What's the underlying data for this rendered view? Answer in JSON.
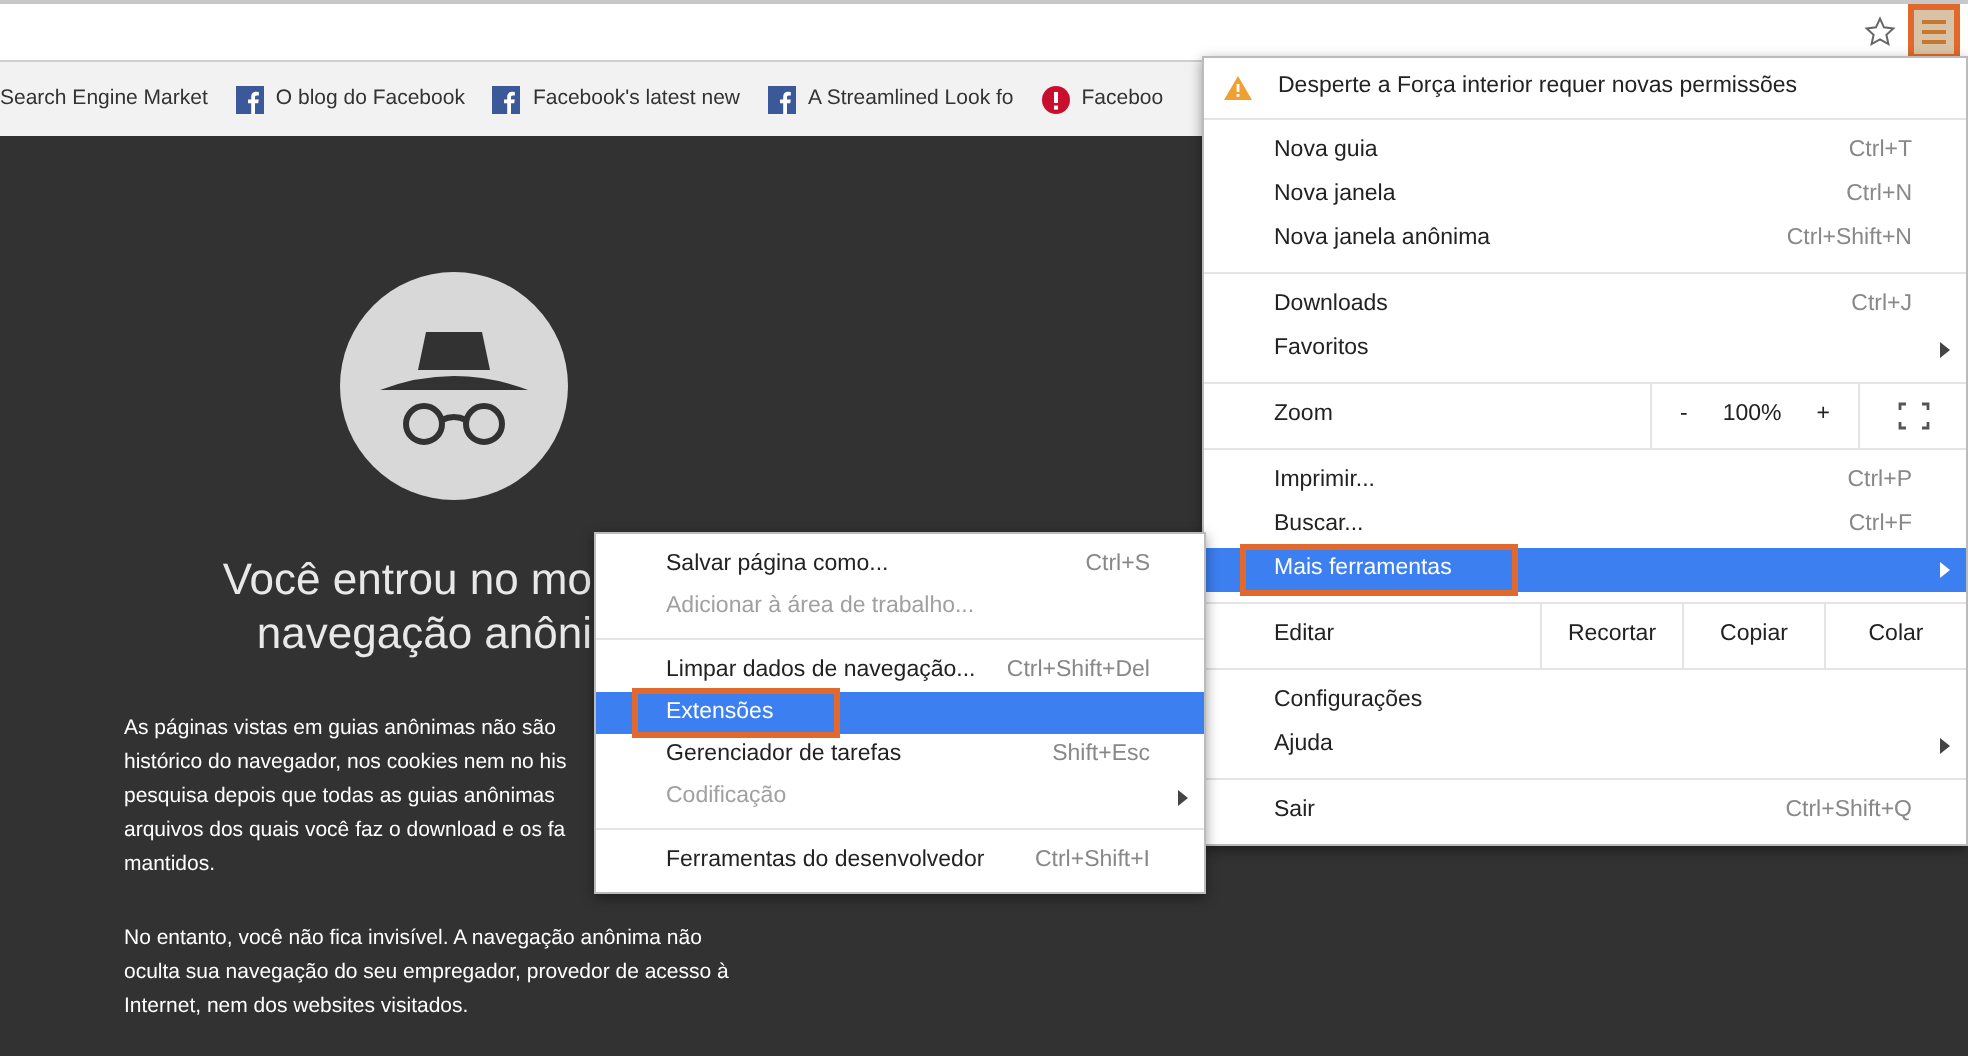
{
  "toolbar": {
    "menu_button": {
      "annotated": true
    }
  },
  "bookmarks": [
    {
      "kind": "plain",
      "label": "Search Engine Market"
    },
    {
      "kind": "facebook",
      "label": "O blog do Facebook"
    },
    {
      "kind": "facebook",
      "label": "Facebook's latest new"
    },
    {
      "kind": "facebook",
      "label": "A Streamlined Look fo"
    },
    {
      "kind": "alert",
      "label": "Faceboo"
    }
  ],
  "page": {
    "heading_lines": [
      "Você entrou no mo",
      "navegação anôni"
    ],
    "paragraphs": [
      [
        "As páginas vistas em guias anônimas não são",
        "histórico do navegador, nos cookies nem no his",
        "pesquisa depois que todas as guias anônimas",
        "arquivos dos quais você faz o download e os fa",
        "mantidos."
      ],
      [
        "No entanto, você não fica invisível. A navegação anônima não",
        "oculta sua navegação do seu empregador, provedor de acesso à",
        "Internet, nem dos websites visitados."
      ]
    ]
  },
  "menu": {
    "sections": [
      {
        "items": [
          {
            "kind": "warning",
            "label": "Desperte a Força interior requer novas permissões"
          }
        ]
      },
      {
        "items": [
          {
            "kind": "item",
            "label": "Nova guia",
            "shortcut": "Ctrl+T",
            "submenu": false,
            "selected": false,
            "disabled": false,
            "annotated": false
          },
          {
            "kind": "item",
            "label": "Nova janela",
            "shortcut": "Ctrl+N",
            "submenu": false,
            "selected": false,
            "disabled": false,
            "annotated": false
          },
          {
            "kind": "item",
            "label": "Nova janela anônima",
            "shortcut": "Ctrl+Shift+N",
            "submenu": false,
            "selected": false,
            "disabled": false,
            "annotated": false
          }
        ]
      },
      {
        "items": [
          {
            "kind": "item",
            "label": "Downloads",
            "shortcut": "Ctrl+J",
            "submenu": false,
            "selected": false,
            "disabled": false,
            "annotated": false
          },
          {
            "kind": "item",
            "label": "Favoritos",
            "submenu": true,
            "selected": false,
            "disabled": false,
            "annotated": false
          }
        ]
      },
      {
        "items": [
          {
            "kind": "zoom",
            "label": "Zoom",
            "minus": "-",
            "value": "100%",
            "plus": "+"
          }
        ]
      },
      {
        "items": [
          {
            "kind": "item",
            "label": "Imprimir...",
            "shortcut": "Ctrl+P",
            "submenu": false,
            "selected": false,
            "disabled": false,
            "annotated": false
          },
          {
            "kind": "item",
            "label": "Buscar...",
            "shortcut": "Ctrl+F",
            "submenu": false,
            "selected": false,
            "disabled": false,
            "annotated": false
          },
          {
            "kind": "item",
            "label": "Mais ferramentas",
            "submenu": true,
            "selected": true,
            "disabled": false,
            "annotated": true
          }
        ]
      },
      {
        "items": [
          {
            "kind": "edit",
            "label": "Editar",
            "buttons": [
              "Recortar",
              "Copiar",
              "Colar"
            ]
          }
        ]
      },
      {
        "items": [
          {
            "kind": "item",
            "label": "Configurações",
            "submenu": false,
            "selected": false,
            "disabled": false,
            "annotated": false
          },
          {
            "kind": "item",
            "label": "Ajuda",
            "submenu": true,
            "selected": false,
            "disabled": false,
            "annotated": false
          }
        ]
      },
      {
        "items": [
          {
            "kind": "item",
            "label": "Sair",
            "shortcut": "Ctrl+Shift+Q",
            "submenu": false,
            "selected": false,
            "disabled": false,
            "annotated": false
          }
        ]
      }
    ]
  },
  "submenu": {
    "sections": [
      {
        "items": [
          {
            "kind": "item",
            "label": "Salvar página como...",
            "shortcut": "Ctrl+S",
            "submenu": false,
            "selected": false,
            "disabled": false,
            "annotated": false
          },
          {
            "kind": "item",
            "label": "Adicionar à área de trabalho...",
            "submenu": false,
            "selected": false,
            "disabled": true,
            "annotated": false
          }
        ]
      },
      {
        "items": [
          {
            "kind": "item",
            "label": "Limpar dados de navegação...",
            "shortcut": "Ctrl+Shift+Del",
            "submenu": false,
            "selected": false,
            "disabled": false,
            "annotated": false
          },
          {
            "kind": "item",
            "label": "Extensões",
            "submenu": false,
            "selected": true,
            "disabled": false,
            "annotated": true
          },
          {
            "kind": "item",
            "label": "Gerenciador de tarefas",
            "shortcut": "Shift+Esc",
            "submenu": false,
            "selected": false,
            "disabled": false,
            "annotated": false
          },
          {
            "kind": "item",
            "label": "Codificação",
            "submenu": true,
            "selected": false,
            "disabled": true,
            "annotated": false
          }
        ]
      },
      {
        "items": [
          {
            "kind": "item",
            "label": "Ferramentas do desenvolvedor",
            "shortcut": "Ctrl+Shift+I",
            "submenu": false,
            "selected": false,
            "disabled": false,
            "annotated": false
          }
        ]
      }
    ]
  }
}
